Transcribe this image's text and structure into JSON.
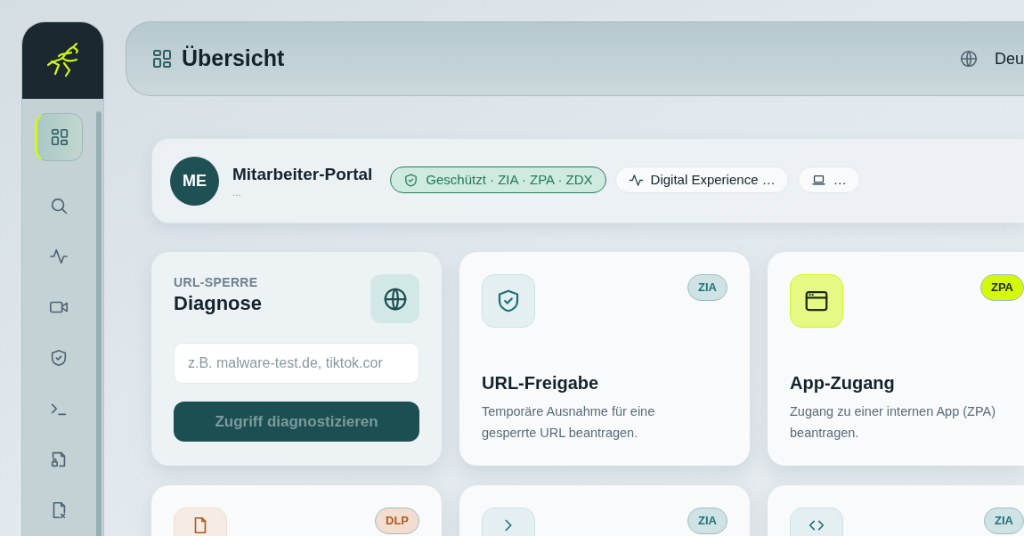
{
  "sidebar": {
    "items": [
      {
        "kind": "dashboard",
        "selected": true
      },
      {
        "kind": "search",
        "selected": false
      },
      {
        "kind": "activity",
        "selected": false
      },
      {
        "kind": "video",
        "selected": false
      },
      {
        "kind": "shield",
        "selected": false
      },
      {
        "kind": "terminal",
        "selected": false
      },
      {
        "kind": "file-lock",
        "selected": false
      },
      {
        "kind": "file-x",
        "selected": false
      }
    ]
  },
  "header": {
    "title": "Übersicht",
    "language": "Deu"
  },
  "profile": {
    "initials": "ME",
    "name": "Mitarbeiter-Portal",
    "subtitle": "…",
    "pills": [
      {
        "kind": "status",
        "label": "Geschützt · ZIA · ZPA · ZDX"
      },
      {
        "kind": "activity",
        "label": "Digital Experience …"
      },
      {
        "kind": "device",
        "label": "…"
      }
    ]
  },
  "cards": [
    {
      "kind": "diagnose",
      "eyebrow": "URL-SPERRE",
      "title": "Diagnose",
      "placeholder": "z.B. malware-test.de, tiktok.cor",
      "button": "Zugriff diagnostizieren"
    },
    {
      "kind": "action",
      "badge": "ZIA",
      "color": "#cfe3e5",
      "title": "URL-Freigabe",
      "description": "Temporäre Ausnahme für eine gesperrte URL beantragen."
    },
    {
      "kind": "action",
      "badge": "ZPA",
      "color": "#d4f70e",
      "title": "App-Zugang",
      "description": "Zugang zu einer internen App (ZPA) beantragen."
    },
    {
      "kind": "action",
      "badge": "DLP",
      "color": "#f2ddd0"
    },
    {
      "kind": "action",
      "badge": "ZIA",
      "color": "#cfe3e5"
    },
    {
      "kind": "action",
      "badge": "ZIA",
      "color": "#cfe3e5"
    }
  ]
}
